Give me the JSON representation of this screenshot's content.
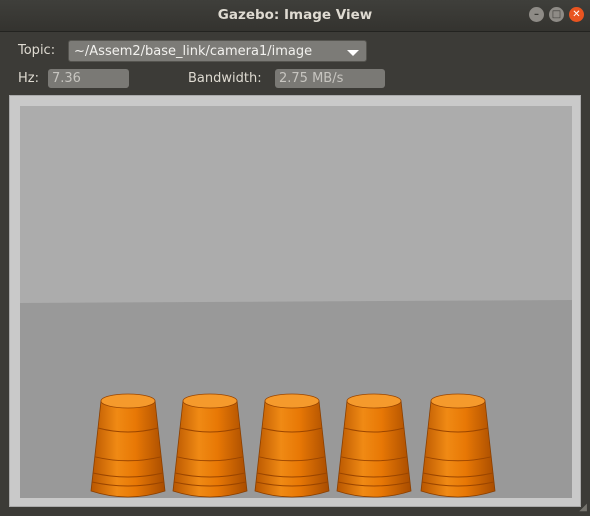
{
  "window": {
    "title": "Gazebo: Image View"
  },
  "controls": {
    "topic_label": "Topic:",
    "topic_value": "~/Assem2/base_link/camera1/image",
    "hz_label": "Hz:",
    "hz_value": "7.36",
    "bandwidth_label": "Bandwidth:",
    "bandwidth_value": "2.75 MB/s"
  },
  "colors": {
    "accent": "#e95420",
    "cup": "#f07a0a"
  },
  "icons": {
    "minimize": "minimize-icon",
    "maximize": "maximize-icon",
    "close": "close-icon",
    "dropdown": "chevron-down-icon"
  }
}
